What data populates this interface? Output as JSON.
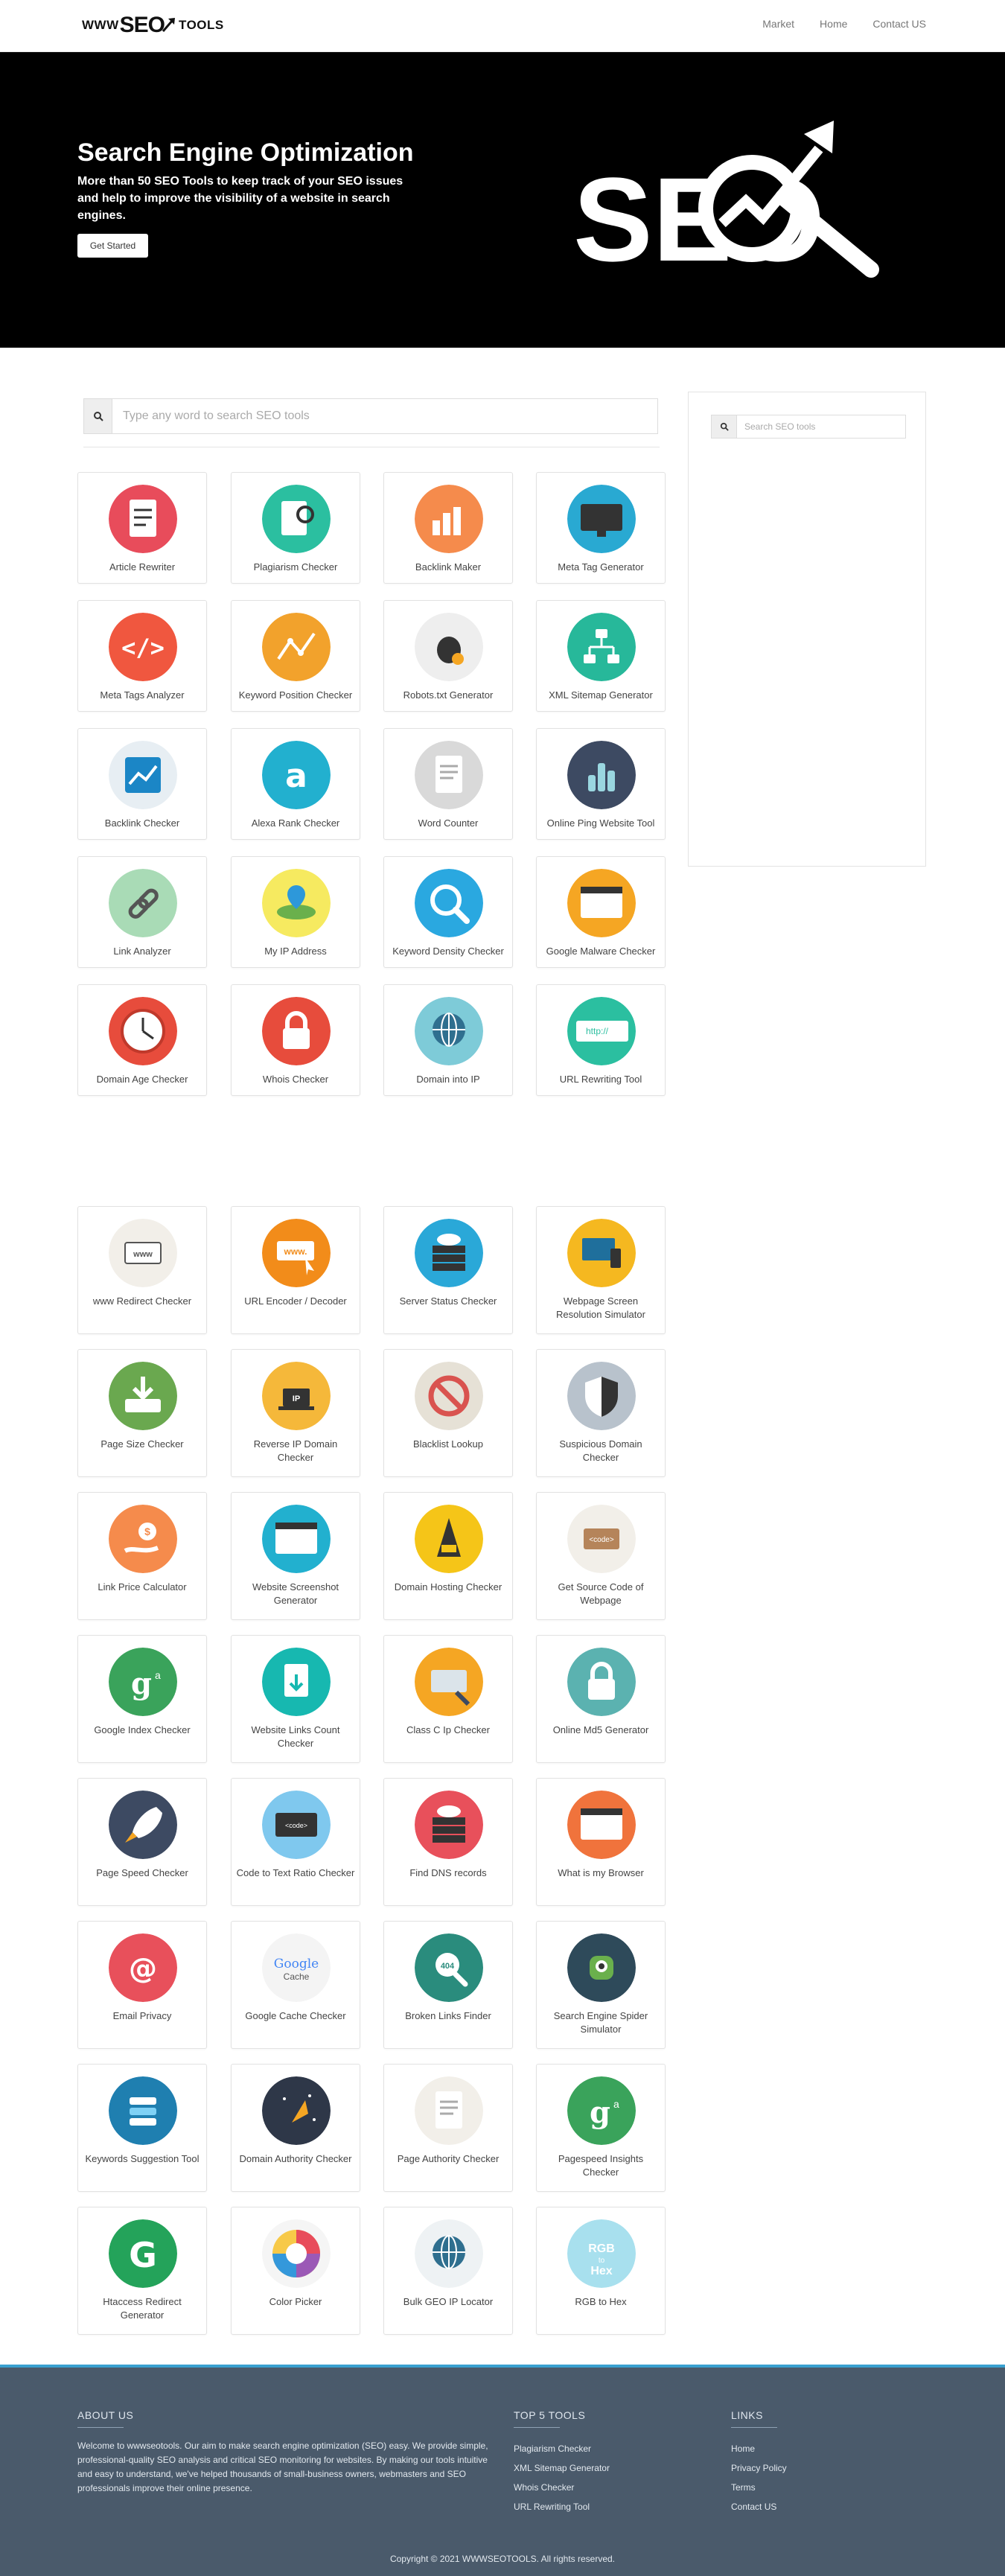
{
  "nav": {
    "logo_www": "WWW",
    "logo_seo": "SEO",
    "logo_tools": "TOOLS",
    "links": [
      "Market",
      "Home",
      "Contact US"
    ]
  },
  "hero": {
    "title": "Search Engine Optimization",
    "subtitle": "More than 50 SEO Tools to keep track of your SEO issues and help to improve the visibility of a website in search engines.",
    "button": "Get Started",
    "art_text": "SEO"
  },
  "search": {
    "placeholder": "Type any word to search SEO tools"
  },
  "sidebar": {
    "search_placeholder": "Search SEO tools"
  },
  "tools_top": [
    {
      "label": "Article Rewriter",
      "icon": "article-rewriter-icon",
      "color": "#e84c5b"
    },
    {
      "label": "Plagiarism Checker",
      "icon": "plagiarism-icon",
      "color": "#2bbfa0"
    },
    {
      "label": "Backlink Maker",
      "icon": "backlink-maker-icon",
      "color": "#f58b4c"
    },
    {
      "label": "Meta Tag Generator",
      "icon": "meta-tag-icon",
      "color": "#29a9d2"
    },
    {
      "label": "Meta Tags Analyzer",
      "icon": "code-icon",
      "color": "#f0573f"
    },
    {
      "label": "Keyword Position Checker",
      "icon": "keyword-position-icon",
      "color": "#f2a22c"
    },
    {
      "label": "Robots.txt Generator",
      "icon": "robot-bug-icon",
      "color": "#eeeeee"
    },
    {
      "label": "XML Sitemap Generator",
      "icon": "sitemap-icon",
      "color": "#27b89a"
    },
    {
      "label": "Backlink Checker",
      "icon": "chart-icon",
      "color": "#e7eef3"
    },
    {
      "label": "Alexa Rank Checker",
      "icon": "alexa-icon",
      "color": "#22b0cf"
    },
    {
      "label": "Word Counter",
      "icon": "document-icon",
      "color": "#d9d9d9"
    },
    {
      "label": "Online Ping Website Tool",
      "icon": "ping-icon",
      "color": "#3d4a62"
    },
    {
      "label": "Link Analyzer",
      "icon": "link-icon",
      "color": "#a9dbb6"
    },
    {
      "label": "My IP Address",
      "icon": "map-pin-icon",
      "color": "#f6ea60"
    },
    {
      "label": "Keyword Density Checker",
      "icon": "magnifier-icon",
      "color": "#2aa8e0"
    },
    {
      "label": "Google Malware Checker",
      "icon": "browser-icon",
      "color": "#f5a623"
    },
    {
      "label": "Domain Age Checker",
      "icon": "clock-icon",
      "color": "#e74c3c"
    },
    {
      "label": "Whois Checker",
      "icon": "lock-icon",
      "color": "#e74c3c"
    },
    {
      "label": "Domain into IP",
      "icon": "globe-ip-icon",
      "color": "#7ecbd8"
    },
    {
      "label": "URL Rewriting Tool",
      "icon": "url-icon",
      "color": "#2bbfa0"
    }
  ],
  "tools_bottom": [
    {
      "label": "www Redirect Checker",
      "icon": "www-icon",
      "color": "#f2efe9"
    },
    {
      "label": "URL Encoder / Decoder",
      "icon": "www-cursor-icon",
      "color": "#f28c1a"
    },
    {
      "label": "Server Status Checker",
      "icon": "server-cloud-icon",
      "color": "#2aa8d8"
    },
    {
      "label": "Webpage Screen Resolution Simulator",
      "icon": "devices-icon",
      "color": "#f5b820"
    },
    {
      "label": "Page Size Checker",
      "icon": "download-icon",
      "color": "#6aa84f"
    },
    {
      "label": "Reverse IP Domain Checker",
      "icon": "ip-laptop-icon",
      "color": "#f5b83a"
    },
    {
      "label": "Blacklist Lookup",
      "icon": "blocked-icon",
      "color": "#e6e1d6"
    },
    {
      "label": "Suspicious Domain Checker",
      "icon": "shield-icon",
      "color": "#b8c2cc"
    },
    {
      "label": "Link Price Calculator",
      "icon": "money-hand-icon",
      "color": "#f58b4c"
    },
    {
      "label": "Website Screenshot Generator",
      "icon": "window-icon",
      "color": "#22b0cf"
    },
    {
      "label": "Domain Hosting Checker",
      "icon": "hosting-icon",
      "color": "#f5c518"
    },
    {
      "label": "Get Source Code of Webpage",
      "icon": "source-code-icon",
      "color": "#f2efe9"
    },
    {
      "label": "Google Index Checker",
      "icon": "google-g-icon",
      "color": "#3aa35b"
    },
    {
      "label": "Website Links Count Checker",
      "icon": "links-count-icon",
      "color": "#17b8b0"
    },
    {
      "label": "Class C Ip Checker",
      "icon": "class-c-icon",
      "color": "#f5a623"
    },
    {
      "label": "Online Md5 Generator",
      "icon": "padlock-icon",
      "color": "#5bb2b0"
    },
    {
      "label": "Page Speed Checker",
      "icon": "rocket-icon",
      "color": "#3d4a62"
    },
    {
      "label": "Code to Text Ratio Checker",
      "icon": "code-text-icon",
      "color": "#7fc8ee"
    },
    {
      "label": "Find DNS records",
      "icon": "dns-server-icon",
      "color": "#e8505b"
    },
    {
      "label": "What is my Browser",
      "icon": "browser-window-icon",
      "color": "#f0733c"
    },
    {
      "label": "Email Privacy",
      "icon": "at-icon",
      "color": "#e8505b"
    },
    {
      "label": "Google Cache Checker",
      "icon": "google-cache-icon",
      "color": "#f4f4f4"
    },
    {
      "label": "Broken Links Finder",
      "icon": "magnifier-404-icon",
      "color": "#2a8c7d"
    },
    {
      "label": "Search Engine Spider Simulator",
      "icon": "spider-robot-icon",
      "color": "#2e4a5a"
    },
    {
      "label": "Keywords Suggestion Tool",
      "icon": "stack-icon",
      "color": "#1f7fb0"
    },
    {
      "label": "Domain Authority Checker",
      "icon": "space-icon",
      "color": "#2e3748"
    },
    {
      "label": "Page Authority Checker",
      "icon": "doc-page-icon",
      "color": "#f2efe9"
    },
    {
      "label": "Pagespeed Insights Checker",
      "icon": "google-g-icon",
      "color": "#3aa35b"
    },
    {
      "label": "Htaccess Redirect Generator",
      "icon": "g-letter-icon",
      "color": "#24a35a"
    },
    {
      "label": "Color Picker",
      "icon": "color-wheel-icon",
      "color": "#f5f5f5"
    },
    {
      "label": "Bulk GEO IP Locator",
      "icon": "globe-stand-icon",
      "color": "#eef2f4"
    },
    {
      "label": "RGB to Hex",
      "icon": "rgb-hex-icon",
      "color": "#a8e0ee"
    }
  ],
  "footer": {
    "about_title": "ABOUT US",
    "about_text": "Welcome to wwwseotools. Our aim to make search engine optimization (SEO) easy. We provide simple, professional-quality SEO analysis and critical SEO monitoring for websites. By making our tools intuitive and easy to understand, we've helped thousands of small-business owners, webmasters and SEO professionals improve their online presence.",
    "top_title": "TOP 5 TOOLS",
    "top_items": [
      "Plagiarism Checker",
      "XML Sitemap Generator",
      "Whois Checker",
      "URL Rewriting Tool"
    ],
    "links_title": "LINKS",
    "links_items": [
      "Home",
      "Privacy Policy",
      "Terms",
      "Contact US"
    ],
    "copyright": "Copyright © 2021 WWWSEOTOOLS. All rights reserved."
  }
}
